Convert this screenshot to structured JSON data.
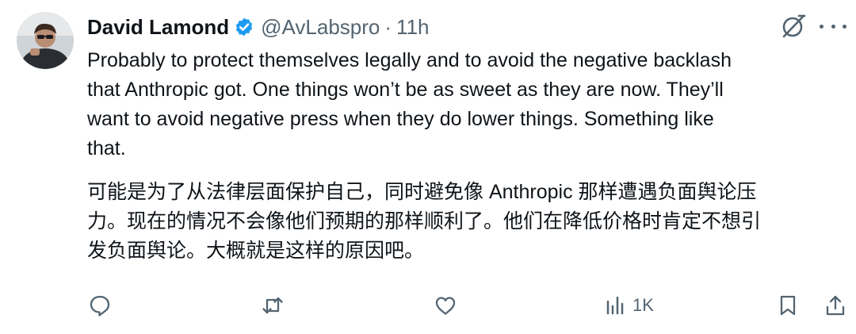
{
  "author": {
    "name": "David Lamond",
    "handle": "@AvLabspro",
    "separator": "·",
    "time": "11h",
    "verified": true
  },
  "post": {
    "english_lines": [
      "Probably to protect themselves legally and to avoid the negative backlash",
      "that Anthropic got. One things won’t be as sweet as they are now. They’ll",
      "want to avoid negative press when they do lower things. Something like",
      "that."
    ],
    "chinese_lines": [
      "可能是为了从法律层面保护自己，同时避免像 Anthropic 那样遭遇负面舆论压",
      "力。现在的情况不会像他们预期的那样顺利了。他们在降低价格时肯定不想引",
      "发负面舆论。大概就是这样的原因吧。"
    ]
  },
  "actions": {
    "reply_icon": "reply-icon",
    "repost_icon": "repost-icon",
    "like_icon": "like-icon",
    "views_icon": "views-icon",
    "views_count": "1K",
    "bookmark_icon": "bookmark-icon",
    "share_icon": "share-icon"
  },
  "colors": {
    "text": "#0f1419",
    "secondary": "#536471",
    "verified": "#1d9bf0"
  }
}
